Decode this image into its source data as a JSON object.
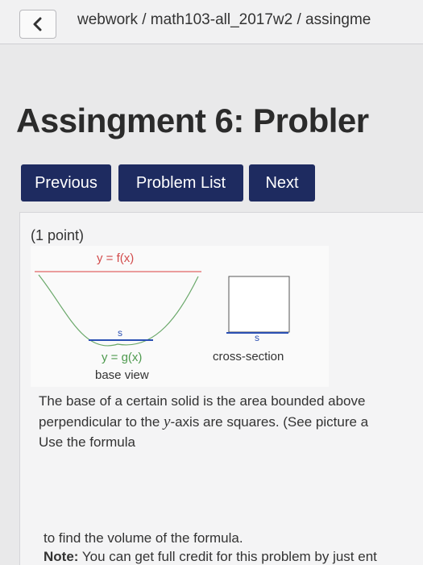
{
  "header": {
    "breadcrumb": "webwork / math103-all_2017w2 / assingme"
  },
  "title": "Assingment 6: Probler",
  "nav": {
    "previous": "Previous",
    "problem_list": "Problem List",
    "next": "Next"
  },
  "problem": {
    "points": "(1 point)",
    "figure": {
      "f_label": "y = f(x)",
      "g_label": "y = g(x)",
      "s_label": "s",
      "base_caption": "base view",
      "cross_caption": "cross-section"
    },
    "line1": "The base of a certain solid is the area bounded above",
    "line2_pre": "perpendicular to the ",
    "line2_var": "y",
    "line2_post": "-axis are squares. (See picture a",
    "line3": "Use the formula",
    "line4": "to find the volume of the formula.",
    "note_label": "Note:",
    "note_text": "You can get full credit for this problem by just ent"
  },
  "colors": {
    "button_bg": "#1e2b60",
    "f_curve": "#e06666",
    "g_curve": "#6aa86a",
    "segment": "#2a4fb3"
  },
  "icons": {
    "back": "chevron-left-icon"
  }
}
